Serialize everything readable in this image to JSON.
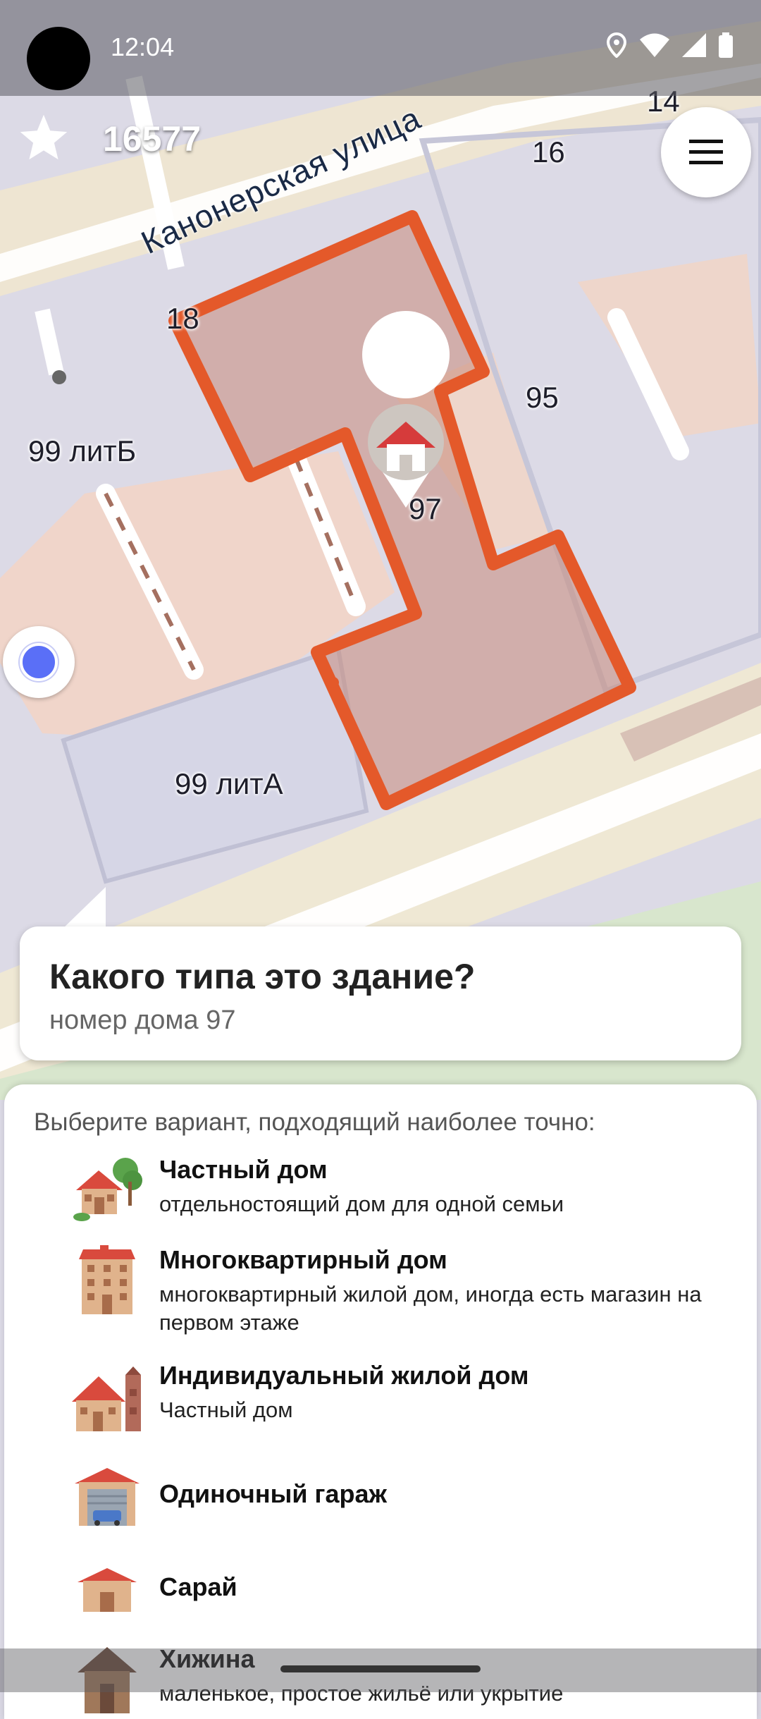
{
  "status_bar": {
    "time": "12:04"
  },
  "toolbar": {
    "score": "16577"
  },
  "map": {
    "street_name": "Канонерская улица",
    "labels": [
      "14",
      "16",
      "18",
      "95",
      "97",
      "99 литБ",
      "99 литА"
    ],
    "highlight_color": "#e4592a"
  },
  "quest": {
    "title": "Какого типа это здание?",
    "subtitle": "номер дома 97"
  },
  "answers": {
    "hint": "Выберите вариант, подходящий наиболее точно:",
    "options": [
      {
        "title": "Частный дом",
        "description": "отдельностоящий дом для одной семьи",
        "icon": "detached-house-icon"
      },
      {
        "title": "Многоквартирный дом",
        "description": "многоквартирный жилой дом, иногда есть магазин на первом этаже",
        "icon": "apartments-icon"
      },
      {
        "title": "Индивидуальный жилой дом",
        "description": "Частный дом",
        "icon": "residential-house-icon"
      },
      {
        "title": "Одиночный гараж",
        "description": "",
        "icon": "garage-icon"
      },
      {
        "title": "Сарай",
        "description": "",
        "icon": "shed-icon"
      },
      {
        "title": "Хижина",
        "description": "маленькое, простое жильё или укрытие",
        "icon": "hut-icon"
      }
    ]
  }
}
